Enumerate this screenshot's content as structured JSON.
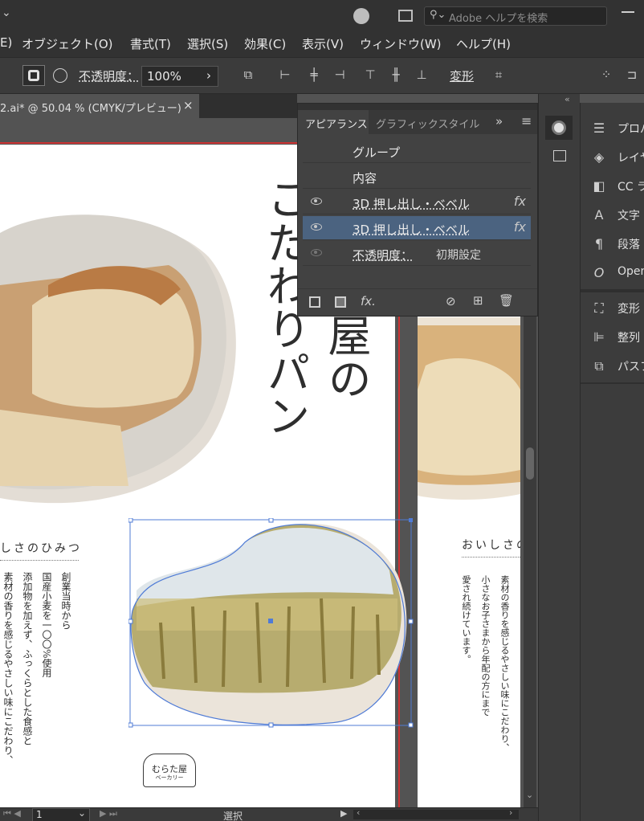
{
  "search": {
    "placeholder": "Adobe ヘルプを検索"
  },
  "menu": {
    "items": [
      "E)",
      "オブジェクト(O)",
      "書式(T)",
      "選択(S)",
      "効果(C)",
      "表示(V)",
      "ウィンドウ(W)",
      "ヘルプ(H)"
    ]
  },
  "control_bar": {
    "opacity_label": "不透明度：",
    "opacity_value": "100%",
    "transform_label": "変形"
  },
  "document_tab": {
    "title": "2.ai* @ 50.04 % (CMYK/プレビュー)",
    "close": "×"
  },
  "appearance_panel": {
    "tabs": [
      "アピアランス",
      "グラフィックスタイル"
    ],
    "rows": [
      {
        "label": "グループ"
      },
      {
        "label": "内容"
      },
      {
        "label": "3D 押し出し・ベベル",
        "fx": "fx"
      },
      {
        "label": "3D 押し出し・ベベル",
        "fx": "fx"
      },
      {
        "label": "不透明度：",
        "value": "初期設定"
      }
    ],
    "footer_fx": "fx."
  },
  "artboard": {
    "headline_col1": "こだわりパン",
    "headline_col2": "屋の",
    "section_heading": "しさのひみつ",
    "body_col1": "創業当時から",
    "body_col2": "国産小麦を一〇〇%使用",
    "body_col3": "添加物を加えず、ふっくらとした食感と",
    "body_col4": "素材の香りを感じるやさしい味にこだわり、",
    "logo_line1": "むらた屋",
    "logo_line2": "ベーカリー",
    "right_heading": "おいしさの",
    "right_col1": "素材の香りを感じるやさしい味にこだわり、",
    "right_col2": "小さなお子さまから年配の方にまで",
    "right_col3": "愛され続けています。"
  },
  "right_panel": {
    "items": [
      {
        "icon": "properties-icon",
        "label": "プロパ"
      },
      {
        "icon": "layers-icon",
        "label": "レイヤ"
      },
      {
        "icon": "cc-libraries-icon",
        "label": "CC ラ"
      },
      {
        "icon": "character-icon",
        "label": "文字"
      },
      {
        "icon": "paragraph-icon",
        "label": "段落"
      },
      {
        "icon": "opentype-icon",
        "label": "Open"
      },
      {
        "icon": "transform-icon",
        "label": "変形"
      },
      {
        "icon": "align-icon",
        "label": "整列"
      },
      {
        "icon": "pathfinder-icon",
        "label": "パスフ"
      }
    ]
  },
  "status_bar": {
    "page": "1",
    "tool": "選択"
  }
}
